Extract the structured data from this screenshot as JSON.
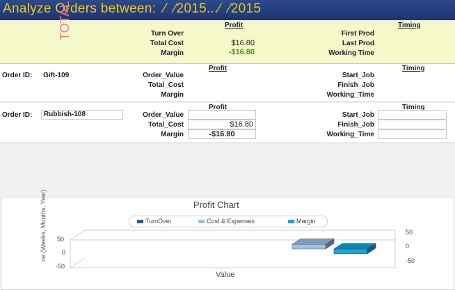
{
  "header": {
    "title": "Analyze Orders between:  ⁄  ⁄2015...⁄  ⁄2015"
  },
  "total": {
    "word": "TOTAL",
    "profit_header": "Profit",
    "timing_header": "Timing",
    "turnover_label": "Turn Over",
    "turnover_value": "",
    "total_cost_label": "Total Cost",
    "total_cost_value": "$16.80",
    "margin_label": "Margin",
    "margin_value": "-$16.80",
    "first_prod_label": "First Prod",
    "last_prod_label": "Last Prod",
    "working_time_label": "Working Time"
  },
  "order1": {
    "order_id_label": "Order ID:",
    "order_id": "Gift-109",
    "profit_header": "Profit",
    "timing_header": "Timing",
    "order_value_label": "Order_Value",
    "total_cost_label": "Total_Cost",
    "margin_label": "Margin",
    "start_job_label": "Start_Job",
    "finish_job_label": "Finish_Job",
    "working_time_label": "Working_Time"
  },
  "order2": {
    "order_id_label": "Order ID:",
    "order_id": "Rubbish-108",
    "profit_header": "Profit",
    "timing_header": "Timing",
    "order_value_label": "Order_Value",
    "order_value": "",
    "total_cost_label": "Total_Cost",
    "total_cost": "$16.80",
    "margin_label": "Margin",
    "margin": "-$16.80",
    "start_job_label": "Start_Job",
    "start_job": "",
    "finish_job_label": "Finish_Job",
    "finish_job": "",
    "working_time_label": "Working_Time",
    "working_time": ""
  },
  "chart_data": {
    "type": "bar",
    "title": "Profit Chart",
    "xlabel": "Value",
    "ylabel": "ne (Weeks, Months, Year)",
    "categories": [
      "Value"
    ],
    "series": [
      {
        "name": "TurnOver",
        "values": [
          0
        ],
        "color": "#1f5ba8"
      },
      {
        "name": "Cost & Expenses",
        "values": [
          16.8
        ],
        "color": "#9cc3e6"
      },
      {
        "name": "Margin",
        "values": [
          -16.8
        ],
        "color": "#1ca3dc"
      }
    ],
    "left_ticks": [
      "50",
      "0",
      "-50"
    ],
    "right_ticks": [
      "50",
      "0",
      "-50"
    ],
    "ylim": [
      -50,
      50
    ],
    "legend_position": "top-center",
    "grid": false
  }
}
